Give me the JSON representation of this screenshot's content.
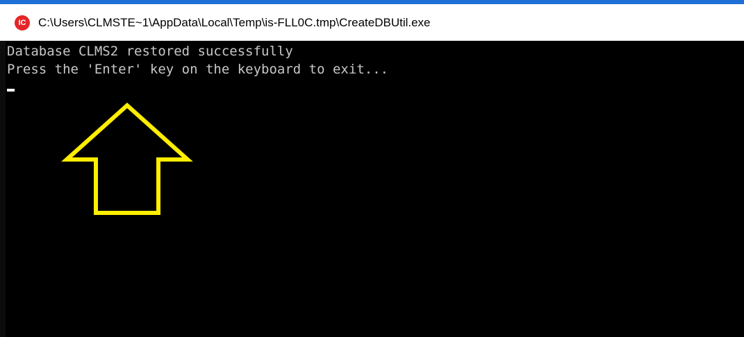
{
  "window": {
    "title": "C:\\Users\\CLMSTE~1\\AppData\\Local\\Temp\\is-FLL0C.tmp\\CreateDBUtil.exe",
    "icon": "app-icon",
    "icon_label": "IC"
  },
  "console": {
    "lines": [
      "Database CLMS2 restored successfully",
      "Press the 'Enter' key on the keyboard to exit..."
    ],
    "foreground_color": "#c7c7c7",
    "background_color": "#000000"
  },
  "annotation": {
    "shape": "up-arrow-outline",
    "color": "#ffee00"
  }
}
